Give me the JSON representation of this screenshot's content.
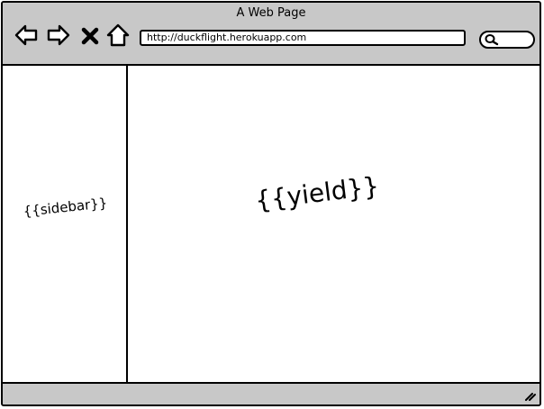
{
  "window": {
    "title": "A Web Page"
  },
  "toolbar": {
    "back_icon": "arrow-left-icon",
    "forward_icon": "arrow-right-icon",
    "stop_icon": "close-icon",
    "home_icon": "home-icon",
    "search_icon": "search-icon"
  },
  "address_bar": {
    "url": "http://duckflight.herokuapp.com"
  },
  "sidebar": {
    "label": "{{sidebar}}"
  },
  "main": {
    "label": "{{yield}}"
  },
  "statusbar": {
    "grip_icon": "resize-grip-icon"
  },
  "colors": {
    "chrome": "#c8c8c8",
    "stroke": "#000000",
    "content": "#ffffff"
  }
}
